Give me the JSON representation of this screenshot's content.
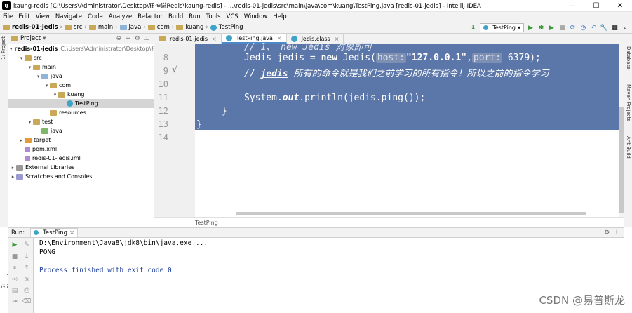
{
  "window": {
    "icon_text": "IJ",
    "title": "kaung-redis [C:\\Users\\Administrator\\Desktop\\狂神说Redis\\kaung-redis] - ...\\redis-01-jedis\\src\\main\\java\\com\\kuang\\TestPing.java [redis-01-jedis] - IntelliJ IDEA",
    "minimize": "—",
    "maximize": "☐",
    "close": "✕"
  },
  "menu": [
    "File",
    "Edit",
    "View",
    "Navigate",
    "Code",
    "Analyze",
    "Refactor",
    "Build",
    "Run",
    "Tools",
    "VCS",
    "Window",
    "Help"
  ],
  "breadcrumb": [
    "redis-01-jedis",
    "src",
    "main",
    "java",
    "com",
    "kuang",
    "TestPing"
  ],
  "run_config": {
    "label": "TestPing",
    "caret": "▾"
  },
  "left_tabs": {
    "project": "1: Project",
    "structure": "7: Structure"
  },
  "right_tabs": {
    "database": "Database",
    "maven": "Maven Projects",
    "ant": "Ant Build"
  },
  "project_panel": {
    "title": "Project",
    "tree": [
      {
        "label": "redis-01-jedis",
        "path": "C:\\Users\\Administrator\\Desktop\\狂",
        "indent": 0,
        "arrow": "▾",
        "icon": "module"
      },
      {
        "label": "src",
        "indent": 1,
        "arrow": "▾",
        "icon": "folder"
      },
      {
        "label": "main",
        "indent": 2,
        "arrow": "▾",
        "icon": "folder"
      },
      {
        "label": "java",
        "indent": 3,
        "arrow": "▾",
        "icon": "folder-blue"
      },
      {
        "label": "com",
        "indent": 4,
        "arrow": "▾",
        "icon": "folder"
      },
      {
        "label": "kuang",
        "indent": 5,
        "arrow": "▾",
        "icon": "folder"
      },
      {
        "label": "TestPing",
        "indent": 6,
        "arrow": "",
        "icon": "class",
        "selected": true
      },
      {
        "label": "resources",
        "indent": 4,
        "arrow": "",
        "icon": "folder"
      },
      {
        "label": "test",
        "indent": 2,
        "arrow": "▾",
        "icon": "folder"
      },
      {
        "label": "java",
        "indent": 3,
        "arrow": "",
        "icon": "folder-green"
      },
      {
        "label": "target",
        "indent": 1,
        "arrow": "▸",
        "icon": "folder-orange"
      },
      {
        "label": "pom.xml",
        "indent": 1,
        "arrow": "",
        "icon": "file"
      },
      {
        "label": "redis-01-jedis.iml",
        "indent": 1,
        "arrow": "",
        "icon": "file"
      },
      {
        "label": "External Libraries",
        "indent": 0,
        "arrow": "▸",
        "icon": "lib"
      },
      {
        "label": "Scratches and Consoles",
        "indent": 0,
        "arrow": "▸",
        "icon": "scratch"
      }
    ]
  },
  "editor_tabs": [
    {
      "label": "redis-01-jedis",
      "active": false,
      "icon": "module"
    },
    {
      "label": "TestPing.java",
      "active": true,
      "icon": "class"
    },
    {
      "label": "Jedis.class",
      "active": false,
      "icon": "class"
    }
  ],
  "editor": {
    "line_numbers": [
      "8",
      "9",
      "10",
      "11",
      "12",
      "13",
      "14"
    ],
    "line7_partial": "// 1、 new Jedis 对象即可",
    "line8": {
      "a": "Jedis jedis = ",
      "kw": "new",
      "b": " Jedis(",
      "hint1": "host:",
      "str": "\"127.0.0.1\"",
      "c": ",",
      "hint2": "port:",
      "d": " 6379);"
    },
    "line9": {
      "prefix": "// ",
      "bold": "jedis",
      "text": " 所有的命令就是我们之前学习的所有指令！所以之前的指令学习"
    },
    "line11": {
      "a": "System.",
      "out": "out",
      "b": ".println(jedis.ping());"
    },
    "line12": "}",
    "line13": "}",
    "checkmark": "√"
  },
  "editor_breadcrumb": "TestPing",
  "run_panel": {
    "label": "Run:",
    "tab": "TestPing",
    "gear": "⚙",
    "hide": "⊥",
    "output": [
      "D:\\Environment\\Java8\\jdk8\\bin\\java.exe ...",
      "PONG",
      "",
      "Process finished with exit code 0"
    ]
  },
  "watermark": "CSDN @易普斯龙"
}
